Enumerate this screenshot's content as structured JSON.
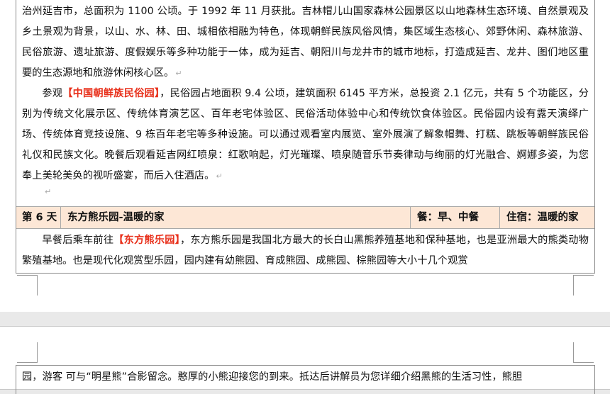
{
  "page1": {
    "para1": "治州延吉市，总面积为 1100 公顷。于 1992 年 11 月获批。吉林帽儿山国家森林公园景区以山地森林生态环境、自然景观及乡土景观为背景，以山、水、林、田、城相依相融为特色，体现朝鲜民族风俗风情，集区域生态核心、郊野休闲、森林旅游、民俗旅游、遗址旅游、度假娱乐等多种功能于一体，成为延吉、朝阳川与龙井市的城市地标，打造成延吉、龙井、图们地区重要的生态源地和旅游休闲核心区。",
    "para2_lead": "参观",
    "para2_highlight": "【中国朝鲜族民俗园】",
    "para2_rest": "，民俗园占地面积 9.4 公顷，建筑面积 6145 平方米，总投资 2.1 亿元，共有 5 个功能区，分别为传统文化展示区、传统体育演艺区、百年老宅体验区、民俗活动体验中心和传统饮食体验区。民俗园内设有露天演绎广场、传统体育竞技设施、9 栋百年老宅等多种设施。可以通过观看室内展览、室外展演了解象帽舞、打糕、跳板等朝鲜族民俗礼仪和民族文化。晚餐后观看延吉网红喷泉：红歌响起，灯光璀璨、喷泉随音乐节奏律动与绚丽的灯光融合、婀娜多姿，为您奉上美轮美奂的视听盛宴，而后入住酒店。",
    "para_mark": "↵",
    "day": {
      "label": "第 6 天",
      "title": "东方熊乐园-温暖的家",
      "meals": "餐：早、中餐",
      "lodging": "住宿：温暖的家"
    },
    "para3_lead": "早餐后乘车前往",
    "para3_highlight": "【东方熊乐园】",
    "para3_rest": "，东方熊乐园是我国北方最大的长白山黑熊养殖基地和保种基地，也是亚洲最大的熊类动物繁殖基地。也是现代化观赏型乐园，园内建有幼熊园、育成熊园、成熊园、棕熊园等大小十几个观赏"
  },
  "page2": {
    "para1": "园，游客 可与“明星熊”合影留念。憨厚的小熊迎接您的到来。抵达后讲解员为您详细介绍黑熊的生活习性，熊胆"
  }
}
